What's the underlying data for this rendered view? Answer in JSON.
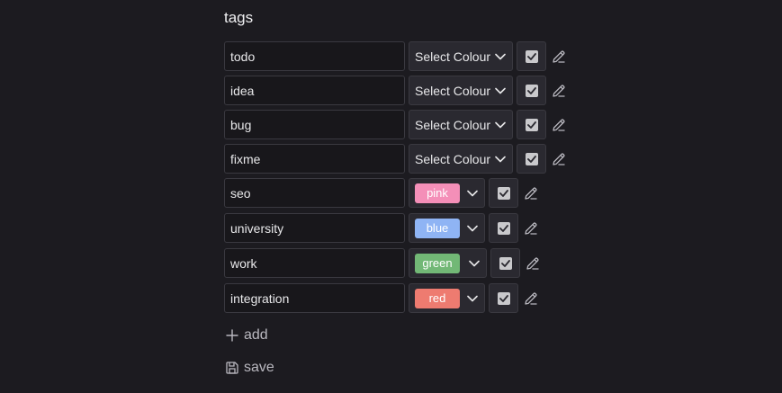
{
  "section": {
    "title": "tags"
  },
  "tags": [
    {
      "name": "todo",
      "colour_label": "Select Colour",
      "colour": null,
      "checked": true
    },
    {
      "name": "idea",
      "colour_label": "Select Colour",
      "colour": null,
      "checked": true
    },
    {
      "name": "bug",
      "colour_label": "Select Colour",
      "colour": null,
      "checked": true
    },
    {
      "name": "fixme",
      "colour_label": "Select Colour",
      "colour": null,
      "checked": true
    },
    {
      "name": "seo",
      "colour_label": "pink",
      "colour": "#f48fb8",
      "checked": true
    },
    {
      "name": "university",
      "colour_label": "blue",
      "colour": "#8fb4f4",
      "checked": true
    },
    {
      "name": "work",
      "colour_label": "green",
      "colour": "#72b876",
      "checked": true
    },
    {
      "name": "integration",
      "colour_label": "red",
      "colour": "#ee7b70",
      "checked": true
    }
  ],
  "actions": {
    "add_label": "add",
    "save_label": "save"
  },
  "icons": {
    "chevron": "chevron-down-icon",
    "edit": "pencil-icon",
    "add": "plus-icon",
    "save": "floppy-disk-icon",
    "check": "checkmark-icon"
  }
}
